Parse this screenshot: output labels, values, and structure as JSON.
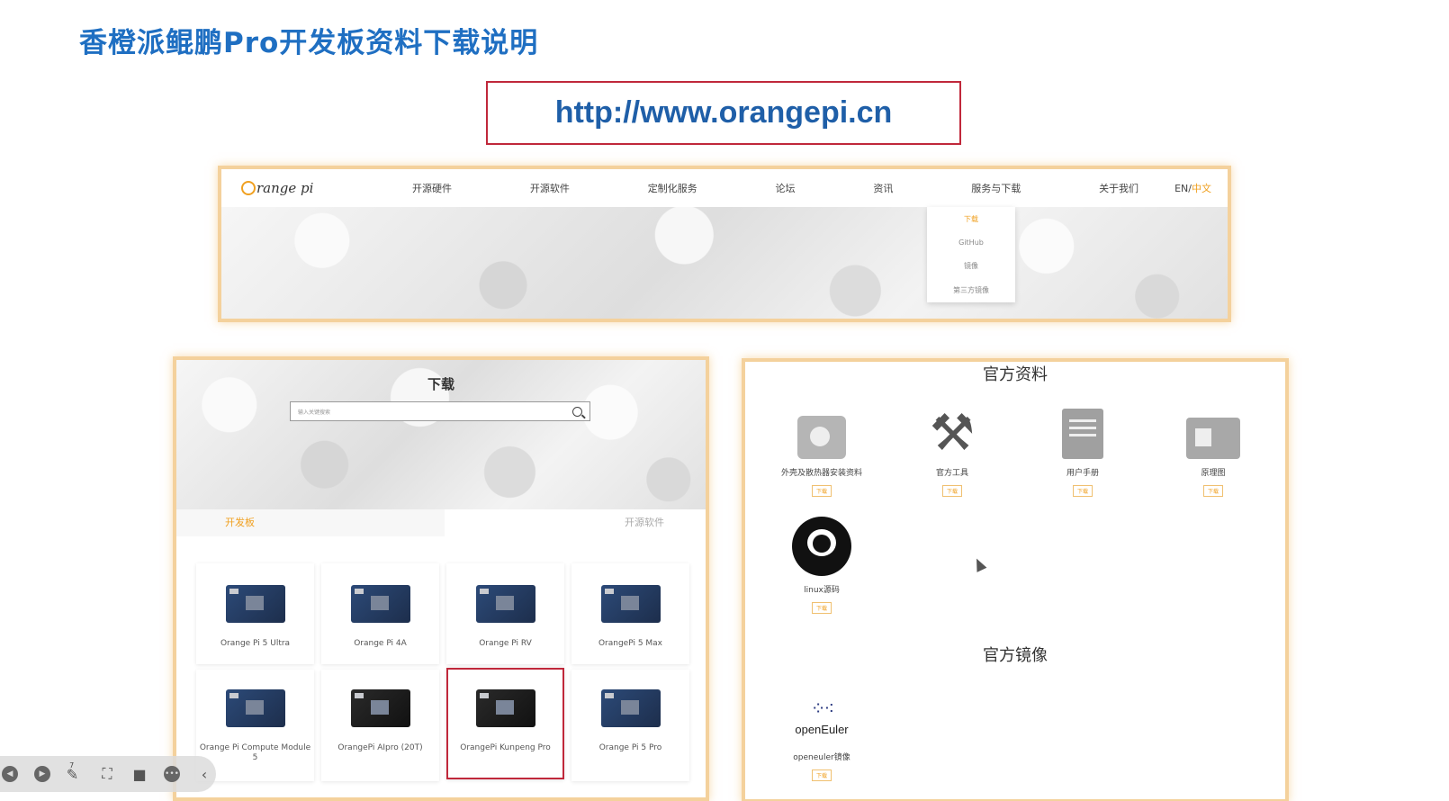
{
  "slide": {
    "title": "香橙派鲲鹏Pro开发板资料下载说明",
    "url": "http://www.orangepi.cn"
  },
  "site": {
    "logo_text": "range pi",
    "nav": [
      "开源硬件",
      "开源软件",
      "定制化服务",
      "论坛",
      "资讯",
      "服务与下载",
      "关于我们"
    ],
    "lang_en": "EN/",
    "lang_cn": "中文",
    "dropdown": [
      "下载",
      "GitHub",
      "镜像",
      "第三方镜像"
    ]
  },
  "download_page": {
    "title": "下载",
    "search_placeholder": "输入关键搜索",
    "tabs": [
      "开发板",
      "开源软件"
    ],
    "boards": [
      "Orange Pi 5 Ultra",
      "Orange Pi 4A",
      "Orange Pi RV",
      "OrangePi 5 Max",
      "Orange Pi Compute Module 5",
      "OrangePi AIpro (20T)",
      "OrangePi Kunpeng Pro",
      "Orange Pi 5 Pro"
    ],
    "selected_board": "OrangePi Kunpeng Pro"
  },
  "resources": {
    "official_docs_title": "官方资料",
    "items": [
      {
        "label": "外壳及散热器安装资料",
        "icon": "kit-icon",
        "button": "下载"
      },
      {
        "label": "官方工具",
        "icon": "tools-icon",
        "button": "下载"
      },
      {
        "label": "用户手册",
        "icon": "manual-icon",
        "button": "下载"
      },
      {
        "label": "原理图",
        "icon": "schematic-icon",
        "button": "下载"
      },
      {
        "label": "linux源码",
        "icon": "github-icon",
        "button": "下载"
      }
    ],
    "official_mirror_title": "官方镜像",
    "mirror": {
      "logo_text": "openEuler",
      "label": "openeuler镜像",
      "button": "下载"
    }
  },
  "toolbar": {
    "badge": "7"
  },
  "colors": {
    "title_blue": "#1f6fc2",
    "url_border": "#c0283b",
    "highlight_border": "#f4d19c",
    "accent_orange": "#f0a020"
  }
}
